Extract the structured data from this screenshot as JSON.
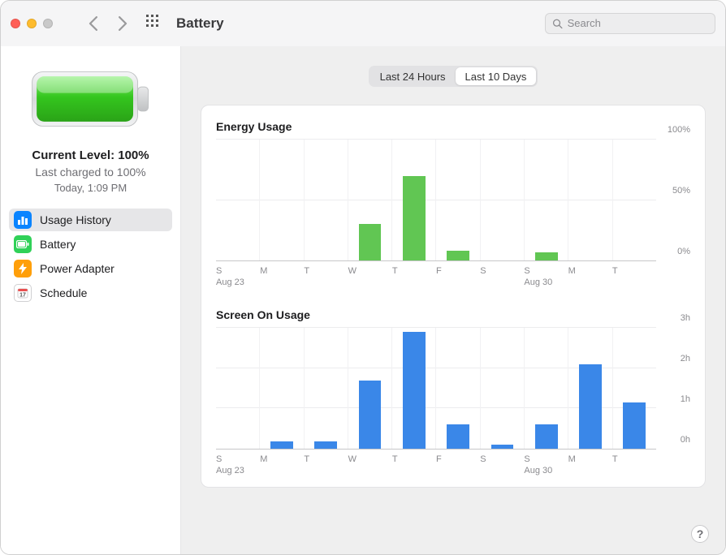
{
  "window": {
    "title": "Battery"
  },
  "search": {
    "placeholder": "Search",
    "value": ""
  },
  "sidebar": {
    "current_level_label": "Current Level: 100%",
    "last_charged_label": "Last charged to 100%",
    "last_charged_time": "Today, 1:09 PM",
    "items": [
      {
        "id": "usage-history",
        "label": "Usage History",
        "selected": true,
        "icon": "bars-icon",
        "color": "blue"
      },
      {
        "id": "battery",
        "label": "Battery",
        "selected": false,
        "icon": "battery-icon",
        "color": "green"
      },
      {
        "id": "power-adapter",
        "label": "Power Adapter",
        "selected": false,
        "icon": "bolt-icon",
        "color": "orange"
      },
      {
        "id": "schedule",
        "label": "Schedule",
        "selected": false,
        "icon": "calendar-icon",
        "color": "white"
      }
    ]
  },
  "segmented": {
    "options": [
      {
        "id": "24h",
        "label": "Last 24 Hours",
        "active": false
      },
      {
        "id": "10d",
        "label": "Last 10 Days",
        "active": true
      }
    ]
  },
  "chart_data": [
    {
      "type": "bar",
      "title": "Energy Usage",
      "categories": [
        "S",
        "M",
        "T",
        "W",
        "T",
        "F",
        "S",
        "S",
        "M",
        "T"
      ],
      "date_labels": [
        "Aug 23",
        "",
        "",
        "",
        "",
        "",
        "",
        "Aug 30",
        "",
        ""
      ],
      "values_pct": [
        0,
        0,
        0,
        30,
        70,
        8,
        0,
        7,
        0,
        0
      ],
      "ylim": [
        0,
        100
      ],
      "yticks": [
        0,
        50,
        100
      ],
      "ytick_labels": [
        "0%",
        "50%",
        "100%"
      ],
      "color": "green"
    },
    {
      "type": "bar",
      "title": "Screen On Usage",
      "categories": [
        "S",
        "M",
        "T",
        "W",
        "T",
        "F",
        "S",
        "S",
        "M",
        "T"
      ],
      "date_labels": [
        "Aug 23",
        "",
        "",
        "",
        "",
        "",
        "",
        "Aug 30",
        "",
        ""
      ],
      "values_hours": [
        0,
        0.18,
        0.18,
        1.7,
        2.9,
        0.6,
        0.1,
        0.6,
        2.1,
        1.15
      ],
      "ylim": [
        0,
        3
      ],
      "yticks": [
        0,
        1,
        2,
        3
      ],
      "ytick_labels": [
        "0h",
        "1h",
        "2h",
        "3h"
      ],
      "color": "blue"
    }
  ],
  "help_label": "?"
}
